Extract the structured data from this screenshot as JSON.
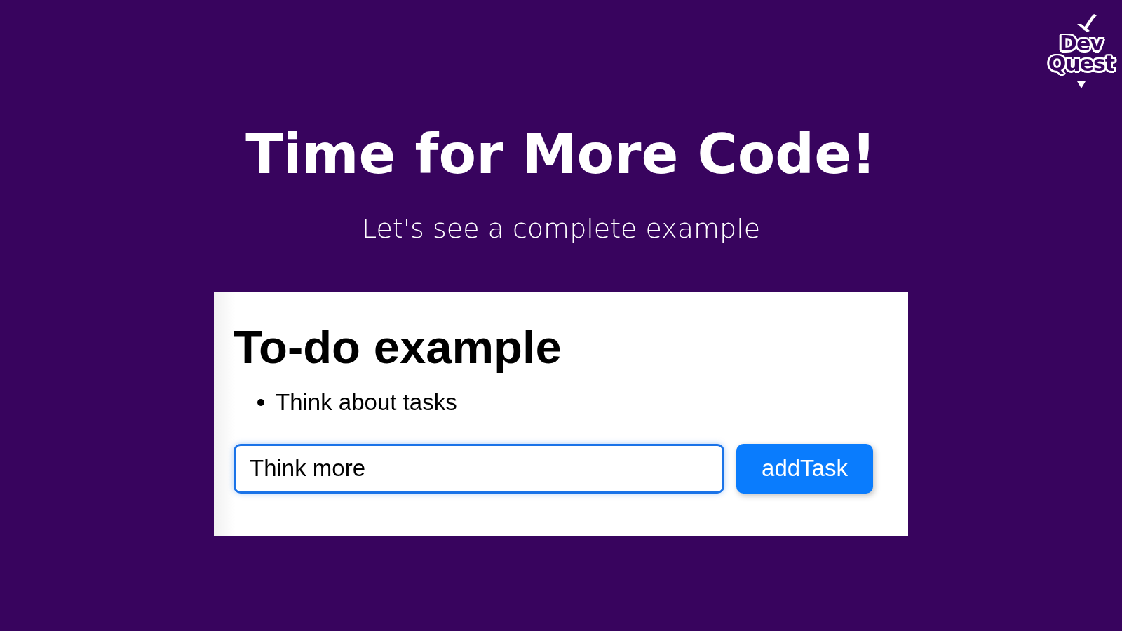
{
  "logo": {
    "lines": [
      "Dev",
      "Quest"
    ]
  },
  "title": "Time for More Code!",
  "subtitle": "Let's see a complete example",
  "demo": {
    "heading": "To-do example",
    "tasks": [
      "Think about tasks"
    ],
    "input": {
      "value": "Think more"
    },
    "button": "addTask"
  }
}
